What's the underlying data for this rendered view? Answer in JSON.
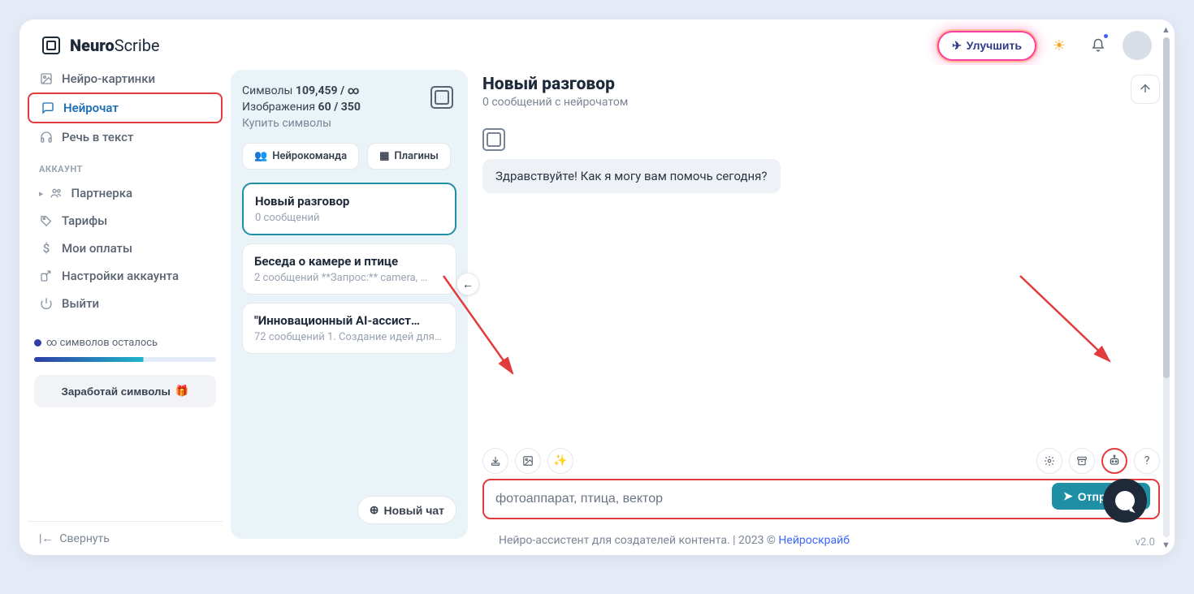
{
  "brand": {
    "name_bold": "Neuro",
    "name_light": "Scribe"
  },
  "header": {
    "improve_label": "Улучшить"
  },
  "sidebar": {
    "items_top": [
      {
        "icon": "image-icon",
        "label": "Нейро-картинки"
      },
      {
        "icon": "chat-icon",
        "label": "Нейрочат"
      },
      {
        "icon": "headphones-icon",
        "label": "Речь в текст"
      }
    ],
    "section_label": "АККАУНТ",
    "items_account": [
      {
        "icon": "users-icon",
        "label": "Партнерка",
        "has_caret": true
      },
      {
        "icon": "tag-icon",
        "label": "Тарифы"
      },
      {
        "icon": "dollar-icon",
        "label": "Мои оплаты"
      },
      {
        "icon": "settings-out-icon",
        "label": "Настройки аккаунта"
      },
      {
        "icon": "power-icon",
        "label": "Выйти"
      }
    ],
    "usage_text": "∞ символов осталось",
    "earn_label": "Заработай символы",
    "earn_emoji": "🎁",
    "collapse_label": "Свернуть"
  },
  "panel": {
    "symbols_label": "Символы",
    "symbols_value": "109,459 / ∞",
    "images_label": "Изображения",
    "images_value": "60 / 350",
    "buy_label": "Купить символы",
    "pill_team": "Нейрокоманда",
    "pill_plugins": "Плагины",
    "conversations": [
      {
        "title": "Новый разговор",
        "sub": "0 сообщений",
        "active": true
      },
      {
        "title": "Беседа о камере и птице",
        "sub": "2 сообщений    **Запрос:** camera, …"
      },
      {
        "title": "\"Инновационный AI-ассист…",
        "sub": "72 сообщений   1. Создание идей для…"
      }
    ],
    "new_chat_label": "Новый чат"
  },
  "chat": {
    "title": "Новый разговор",
    "subtitle": "0 сообщений с нейрочатом",
    "greeting": "Здравствуйте! Как я могу вам помочь сегодня?",
    "input_value": "фотоаппарат, птица, вектор",
    "send_label": "Отправить"
  },
  "footer": {
    "text_prefix": "Нейро-ассистент для создателей контента.  | 2023 © ",
    "link_text": "Нейроскрайб",
    "version": "v2.0"
  },
  "colors": {
    "accent": "#1f8fa6",
    "highlight": "#e23b3b"
  }
}
